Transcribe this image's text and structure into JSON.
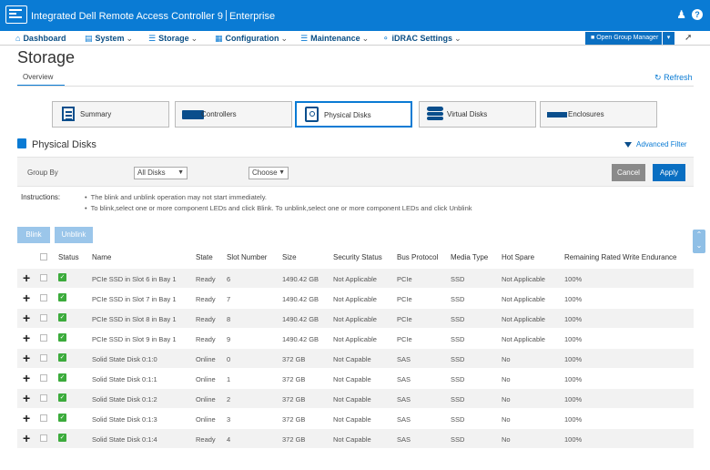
{
  "header": {
    "product": "Integrated Dell Remote Access Controller 9",
    "edition": "Enterprise"
  },
  "nav": {
    "items": [
      {
        "label": "Dashboard",
        "icon": "home-icon"
      },
      {
        "label": "System",
        "icon": "server-icon"
      },
      {
        "label": "Storage",
        "icon": "storage-icon"
      },
      {
        "label": "Configuration",
        "icon": "config-icon"
      },
      {
        "label": "Maintenance",
        "icon": "list-icon"
      },
      {
        "label": "iDRAC Settings",
        "icon": "key-icon"
      }
    ],
    "group_manager": "Open Group Manager"
  },
  "page": {
    "title": "Storage",
    "tab": "Overview",
    "refresh": "Refresh"
  },
  "categories": [
    {
      "label": "Summary"
    },
    {
      "label": "Controllers"
    },
    {
      "label": "Physical Disks"
    },
    {
      "label": "Virtual Disks"
    },
    {
      "label": "Enclosures"
    }
  ],
  "section": {
    "title": "Physical Disks",
    "advanced_filter": "Advanced Filter"
  },
  "filter": {
    "group_by_label": "Group By",
    "group_by_value": "All Disks",
    "choose_value": "Choose",
    "cancel": "Cancel",
    "apply": "Apply"
  },
  "instructions": {
    "label": "Instructions:",
    "lines": [
      "The blink and unblink operation may not start immediately.",
      "To blink,select one or more component LEDs and click Blink. To unblink,select one or more component LEDs and click Unblink"
    ]
  },
  "actions": {
    "blink": "Blink",
    "unblink": "Unblink"
  },
  "table": {
    "headers": [
      "Status",
      "Name",
      "State",
      "Slot Number",
      "Size",
      "Security Status",
      "Bus Protocol",
      "Media Type",
      "Hot Spare",
      "Remaining Rated Write Endurance"
    ],
    "rows": [
      {
        "name": "PCIe SSD in Slot 6 in Bay 1",
        "state": "Ready",
        "slot": "6",
        "size": "1490.42 GB",
        "security": "Not Applicable",
        "bus": "PCIe",
        "media": "SSD",
        "hotspare": "Not Applicable",
        "endurance": "100%"
      },
      {
        "name": "PCIe SSD in Slot 7 in Bay 1",
        "state": "Ready",
        "slot": "7",
        "size": "1490.42 GB",
        "security": "Not Applicable",
        "bus": "PCIe",
        "media": "SSD",
        "hotspare": "Not Applicable",
        "endurance": "100%"
      },
      {
        "name": "PCIe SSD in Slot 8 in Bay 1",
        "state": "Ready",
        "slot": "8",
        "size": "1490.42 GB",
        "security": "Not Applicable",
        "bus": "PCIe",
        "media": "SSD",
        "hotspare": "Not Applicable",
        "endurance": "100%"
      },
      {
        "name": "PCIe SSD in Slot 9 in Bay 1",
        "state": "Ready",
        "slot": "9",
        "size": "1490.42 GB",
        "security": "Not Applicable",
        "bus": "PCIe",
        "media": "SSD",
        "hotspare": "Not Applicable",
        "endurance": "100%"
      },
      {
        "name": "Solid State Disk 0:1:0",
        "state": "Online",
        "slot": "0",
        "size": "372 GB",
        "security": "Not Capable",
        "bus": "SAS",
        "media": "SSD",
        "hotspare": "No",
        "endurance": "100%"
      },
      {
        "name": "Solid State Disk 0:1:1",
        "state": "Online",
        "slot": "1",
        "size": "372 GB",
        "security": "Not Capable",
        "bus": "SAS",
        "media": "SSD",
        "hotspare": "No",
        "endurance": "100%"
      },
      {
        "name": "Solid State Disk 0:1:2",
        "state": "Online",
        "slot": "2",
        "size": "372 GB",
        "security": "Not Capable",
        "bus": "SAS",
        "media": "SSD",
        "hotspare": "No",
        "endurance": "100%"
      },
      {
        "name": "Solid State Disk 0:1:3",
        "state": "Online",
        "slot": "3",
        "size": "372 GB",
        "security": "Not Capable",
        "bus": "SAS",
        "media": "SSD",
        "hotspare": "No",
        "endurance": "100%"
      },
      {
        "name": "Solid State Disk 0:1:4",
        "state": "Ready",
        "slot": "4",
        "size": "372 GB",
        "security": "Not Capable",
        "bus": "SAS",
        "media": "SSD",
        "hotspare": "No",
        "endurance": "100%"
      }
    ]
  },
  "colors": {
    "brand": "#0a7bd4",
    "ok_status": "#3cab3c"
  }
}
